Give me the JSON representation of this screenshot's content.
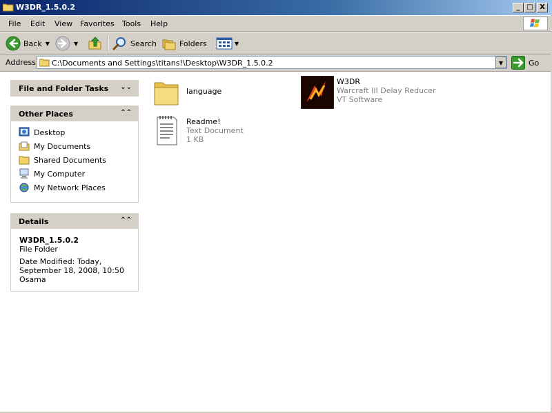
{
  "window": {
    "title": "W3DR_1.5.0.2",
    "buttons": {
      "minimize": "_",
      "maximize": "□",
      "close": "X"
    }
  },
  "menu": [
    "File",
    "Edit",
    "View",
    "Favorites",
    "Tools",
    "Help"
  ],
  "toolbar": {
    "back": "Back",
    "search": "Search",
    "folders": "Folders"
  },
  "address": {
    "label": "Address",
    "path": "C:\\Documents and Settings\\titans!\\Desktop\\W3DR_1.5.0.2",
    "go": "Go"
  },
  "taskpane": {
    "file_tasks": {
      "title": "File and Folder Tasks"
    },
    "other_places": {
      "title": "Other Places",
      "items": [
        {
          "label": "Desktop",
          "icon": "desktop-icon"
        },
        {
          "label": "My Documents",
          "icon": "my-documents-icon"
        },
        {
          "label": "Shared Documents",
          "icon": "folder-icon"
        },
        {
          "label": "My Computer",
          "icon": "my-computer-icon"
        },
        {
          "label": "My Network Places",
          "icon": "network-places-icon"
        }
      ]
    },
    "details": {
      "title": "Details",
      "name": "W3DR_1.5.0.2",
      "type": "File Folder",
      "modified_1": "Date Modified: Today,",
      "modified_2": "September 18, 2008, 10:50",
      "owner": "Osama"
    }
  },
  "files": [
    {
      "name": "language",
      "icon": "folder-icon"
    },
    {
      "name": "W3DR",
      "line2": "Warcraft III Delay Reducer",
      "line3": "VT Software",
      "icon": "w3dr-app-icon"
    },
    {
      "name": "Readme!",
      "line2": "Text Document",
      "line3": "1 KB",
      "icon": "text-document-icon"
    }
  ],
  "colors": {
    "title_start": "#0a246a",
    "title_end": "#a6caf0",
    "chrome": "#d4d0c8",
    "secondary_text": "#808080"
  }
}
